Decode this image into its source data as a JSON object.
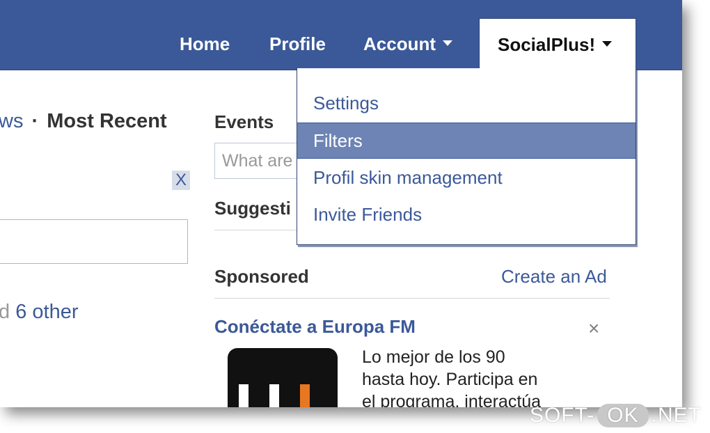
{
  "colors": {
    "topbar": "#3b5998",
    "link": "#3b5998",
    "menu_highlight": "#6d84b4",
    "ad_bar_orange": "#e87722"
  },
  "nav": {
    "home": "Home",
    "profile": "Profile",
    "account": "Account",
    "socialplus": "SocialPlus!"
  },
  "menu": {
    "items": [
      {
        "label": "Settings",
        "active": false
      },
      {
        "label": "Filters",
        "active": true
      },
      {
        "label": "Profil skin management",
        "active": false
      },
      {
        "label": "Invite Friends",
        "active": false
      }
    ]
  },
  "left": {
    "news_fragment": "ws",
    "separator": "·",
    "most_recent": "Most Recent",
    "close_label": "X",
    "other_prefix": "d",
    "other_link": "6 other"
  },
  "right": {
    "events_title": "Events",
    "events_placeholder": "What are",
    "suggestions_title": "Suggesti",
    "sponsored_title": "Sponsored",
    "create_ad": "Create an Ad",
    "ad_title": "Conéctate a Europa FM",
    "ad_close": "×",
    "ad_lines": [
      "Lo mejor de los 90",
      "hasta hoy. Participa en",
      "el programa, interactúa"
    ]
  },
  "watermark": {
    "part1": "SOFT-",
    "part2": "OK",
    "part3": ".NET"
  }
}
